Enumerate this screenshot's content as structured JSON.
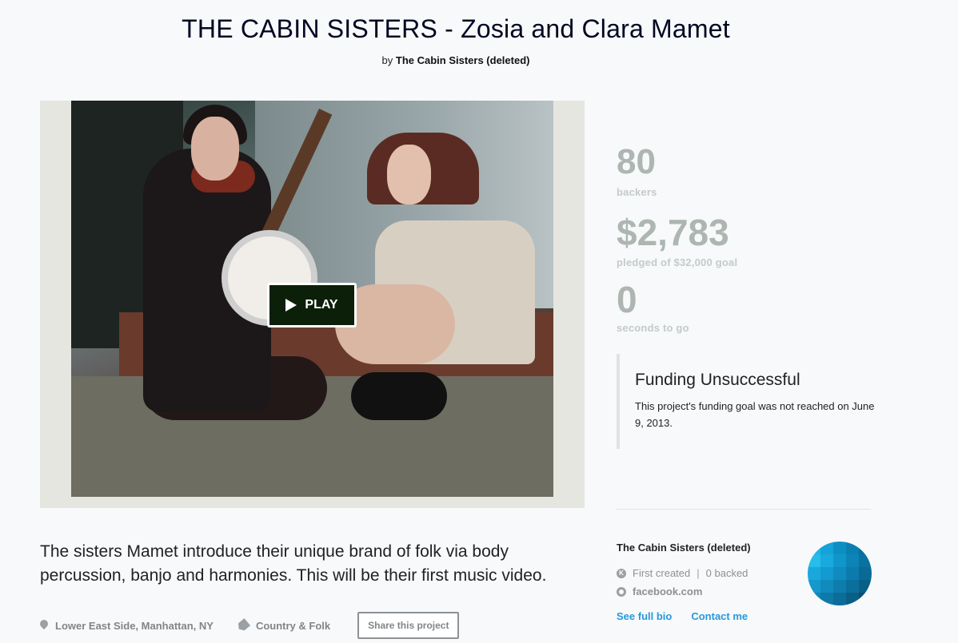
{
  "project": {
    "title": "THE CABIN SISTERS - Zosia and Clara Mamet",
    "by_prefix": "by",
    "creator": "The Cabin Sisters (deleted)"
  },
  "video": {
    "play_label": "PLAY"
  },
  "stats": {
    "backers_count": "80",
    "backers_label": "backers",
    "pledged_amount": "$2,783",
    "pledged_label": "pledged of $32,000 goal",
    "time_left": "0",
    "time_label": "seconds to go"
  },
  "funding": {
    "title": "Funding Unsuccessful",
    "text": "This project's funding goal was not reached on June 9, 2013."
  },
  "blurb": "The sisters Mamet introduce their unique brand of folk via body percussion, banjo and harmonies. This will be their first music video.",
  "meta": {
    "location": "Lower East Side, Manhattan, NY",
    "category": "Country & Folk",
    "share_label": "Share this project"
  },
  "creator_box": {
    "name": "The Cabin Sisters (deleted)",
    "first_created": "First created",
    "separator": "|",
    "backed": "0 backed",
    "website": "facebook.com",
    "see_bio": "See full bio",
    "contact": "Contact me"
  },
  "colors": {
    "accent_link": "#2798dd",
    "stats_gray": "#adb6b1",
    "play_bg": "#0c1f08",
    "page_bg": "#f7f9fa"
  },
  "icons": [
    "play-icon",
    "location-pin-icon",
    "tag-icon",
    "kickstarter-k-icon",
    "globe-icon"
  ]
}
